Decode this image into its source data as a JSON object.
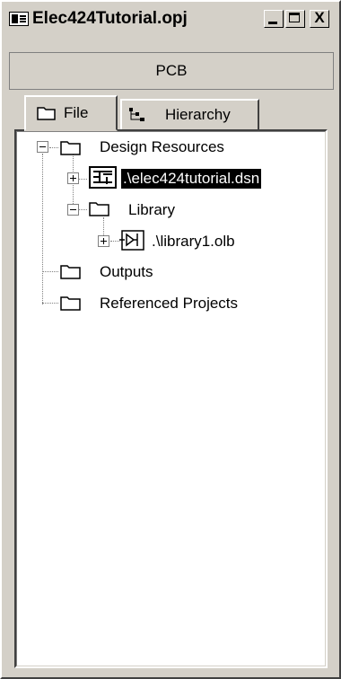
{
  "window": {
    "title": "Elec424Tutorial.opj",
    "minimize": "_",
    "maximize": "□",
    "close": "X"
  },
  "header": {
    "label": "PCB"
  },
  "tabs": [
    {
      "label": "File",
      "active": true
    },
    {
      "label": "Hierarchy",
      "active": false
    }
  ],
  "tree": {
    "design_resources": "Design Resources",
    "dsn": ".\\elec424tutorial.dsn",
    "library": "Library",
    "olb": ".\\library1.olb",
    "outputs": "Outputs",
    "referenced": "Referenced Projects"
  },
  "colors": {
    "face": "#d4d0c8",
    "selection": "#000000"
  }
}
